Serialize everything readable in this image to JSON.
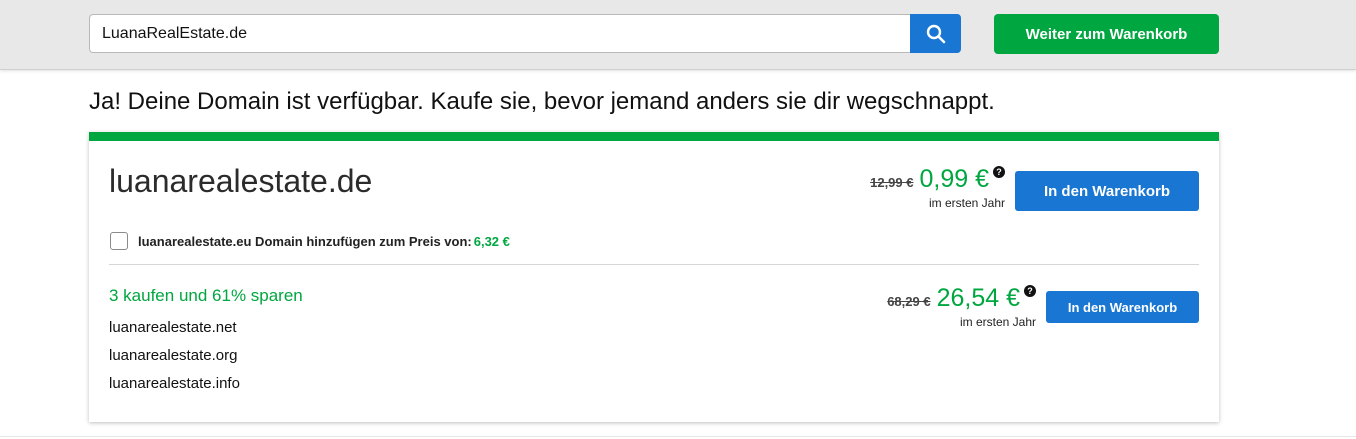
{
  "colors": {
    "accent_green": "#00a63f",
    "accent_blue": "#1976d2",
    "topbar_bg": "#e8e8e8"
  },
  "search": {
    "value": "LuanaRealEstate.de",
    "button_icon": "search-icon"
  },
  "header": {
    "cart_button_label": "Weiter zum Warenkorb"
  },
  "headline": "Ja! Deine Domain ist verfügbar. Kaufe sie, bevor jemand anders sie dir wegschnappt.",
  "primary": {
    "domain": "luanarealestate.de",
    "old_price": "12,99 €",
    "new_price": "0,99 €",
    "price_note": "im ersten Jahr",
    "info_icon": "question-icon",
    "cart_button_label": "In den Warenkorb",
    "addon": {
      "label": "luanarealestate.eu Domain hinzufügen zum Preis von:",
      "price": "6,32 €",
      "checked": false
    }
  },
  "bundle": {
    "heading": "3 kaufen und 61% sparen",
    "domains": [
      "luanarealestate.net",
      "luanarealestate.org",
      "luanarealestate.info"
    ],
    "old_price": "68,29 €",
    "new_price": "26,54 €",
    "price_note": "im ersten Jahr",
    "info_icon": "question-icon",
    "cart_button_label": "In den Warenkorb"
  }
}
